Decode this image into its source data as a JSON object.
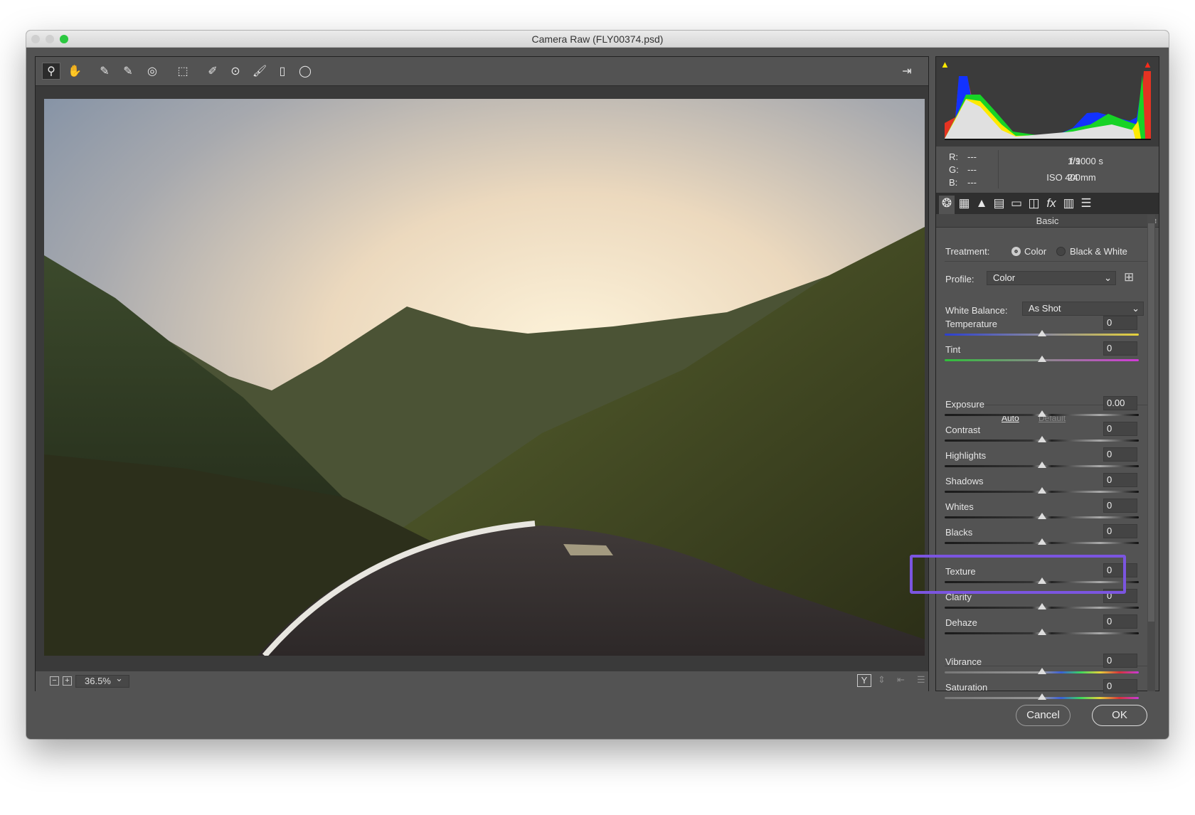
{
  "window": {
    "title": "Camera Raw (FLY00374.psd)"
  },
  "toolbar": {
    "tools": [
      {
        "name": "zoom-tool",
        "glyph": "⚲"
      },
      {
        "name": "hand-tool",
        "glyph": "✋"
      },
      {
        "name": "white-balance-tool",
        "glyph": "✎"
      },
      {
        "name": "color-sampler-tool",
        "glyph": "✎"
      },
      {
        "name": "targeted-adjustment-tool",
        "glyph": "◎"
      },
      {
        "name": "transform-tool",
        "glyph": "⬚"
      },
      {
        "name": "spot-removal-tool",
        "glyph": "✐"
      },
      {
        "name": "red-eye-tool",
        "glyph": "⊙"
      },
      {
        "name": "adjustment-brush-tool",
        "glyph": "🖌"
      },
      {
        "name": "graduated-filter-tool",
        "glyph": "▯"
      },
      {
        "name": "radial-filter-tool",
        "glyph": "◯"
      }
    ],
    "open_preferences_glyph": "⇥"
  },
  "bottombar": {
    "zoom_out": "−",
    "zoom_in": "+",
    "zoom_level": "36.5%",
    "zoom_dropdown": "⌄",
    "view_icons": [
      "Y",
      "⇕",
      "⇤",
      "☰"
    ]
  },
  "info": {
    "r_label": "R:",
    "g_label": "G:",
    "b_label": "B:",
    "r": "---",
    "g": "---",
    "b": "---",
    "aperture": "f/9",
    "shutter": "1/1000 s",
    "iso": "ISO 400",
    "focal": "24 mm"
  },
  "tabs": [
    {
      "name": "basic",
      "glyph": "❂"
    },
    {
      "name": "tone-curve",
      "glyph": "▦"
    },
    {
      "name": "detail",
      "glyph": "▲"
    },
    {
      "name": "hsl",
      "glyph": "▤"
    },
    {
      "name": "split-toning",
      "glyph": "▭"
    },
    {
      "name": "lens-corrections",
      "glyph": "◫"
    },
    {
      "name": "effects",
      "glyph": "fx"
    },
    {
      "name": "calibration",
      "glyph": "▥"
    },
    {
      "name": "presets",
      "glyph": "☰"
    }
  ],
  "panel": {
    "title": "Basic",
    "menu_glyph": "≡",
    "treatment_label": "Treatment:",
    "treatment_options": [
      "Color",
      "Black & White"
    ],
    "treatment_selected": "Color",
    "profile_label": "Profile:",
    "profile_value": "Color",
    "wb_label": "White Balance:",
    "wb_value": "As Shot",
    "auto": "Auto",
    "default": "Default",
    "sliders": [
      {
        "label": "Temperature",
        "value": "0",
        "track": "temp"
      },
      {
        "label": "Tint",
        "value": "0",
        "track": "tint"
      },
      {
        "label": "Exposure",
        "value": "0.00",
        "track": "gray"
      },
      {
        "label": "Contrast",
        "value": "0",
        "track": "gray"
      },
      {
        "label": "Highlights",
        "value": "0",
        "track": "gray"
      },
      {
        "label": "Shadows",
        "value": "0",
        "track": "gray"
      },
      {
        "label": "Whites",
        "value": "0",
        "track": "gray"
      },
      {
        "label": "Blacks",
        "value": "0",
        "track": "gray"
      },
      {
        "label": "Texture",
        "value": "0",
        "track": "gray"
      },
      {
        "label": "Clarity",
        "value": "0",
        "track": "gray"
      },
      {
        "label": "Dehaze",
        "value": "0",
        "track": "gray"
      },
      {
        "label": "Vibrance",
        "value": "0",
        "track": "vib"
      },
      {
        "label": "Saturation",
        "value": "0",
        "track": "vib"
      }
    ]
  },
  "footer": {
    "cancel": "Cancel",
    "ok": "OK"
  },
  "colors": {
    "highlight": "#7b55e0",
    "close": "#d0d0d0",
    "zoom": "#2bc840"
  }
}
